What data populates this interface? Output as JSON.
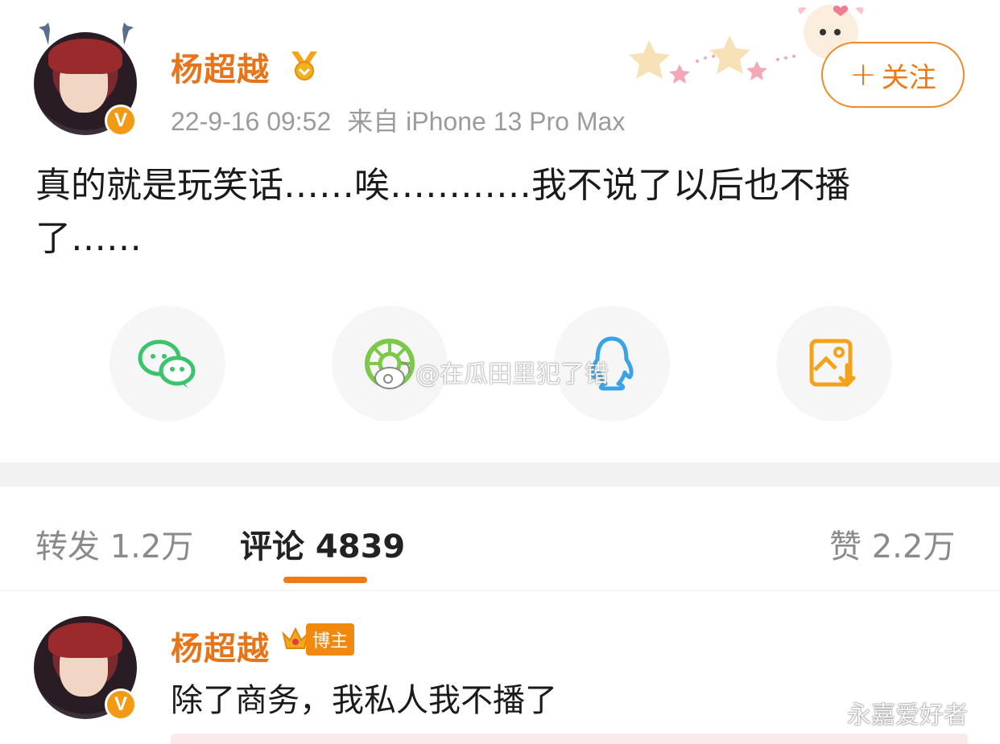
{
  "post": {
    "author": "杨超越",
    "timestamp": "22-9-16 09:52",
    "source": "来自 iPhone 13 Pro Max",
    "follow_label": "关注",
    "follow_plus": "+",
    "content": "真的就是玩笑话……唉…………我不说了以后也不播了……",
    "verified_mark": "V"
  },
  "share": {
    "items": [
      {
        "name": "wechat",
        "icon": "wechat-icon"
      },
      {
        "name": "moments",
        "icon": "moments-icon"
      },
      {
        "name": "qq",
        "icon": "qq-icon"
      },
      {
        "name": "save-image",
        "icon": "save-image-icon"
      }
    ],
    "watermark": "@在瓜田里犯了错"
  },
  "tabs": {
    "repost": "转发 1.2万",
    "comments": "评论 4839",
    "likes": "赞 2.2万"
  },
  "comment": {
    "author": "杨超越",
    "badge": "博主",
    "text": "除了商务，我私人我不播了",
    "verified_mark": "V"
  },
  "watermark_corner": "永嘉爱好者",
  "colors": {
    "accent": "#f07a14",
    "username": "#e8741a",
    "meta_gray": "#9b9b9b",
    "wechat_green": "#3cc36d",
    "qq_blue": "#3aa3e3",
    "save_yellow": "#f4a21c"
  }
}
